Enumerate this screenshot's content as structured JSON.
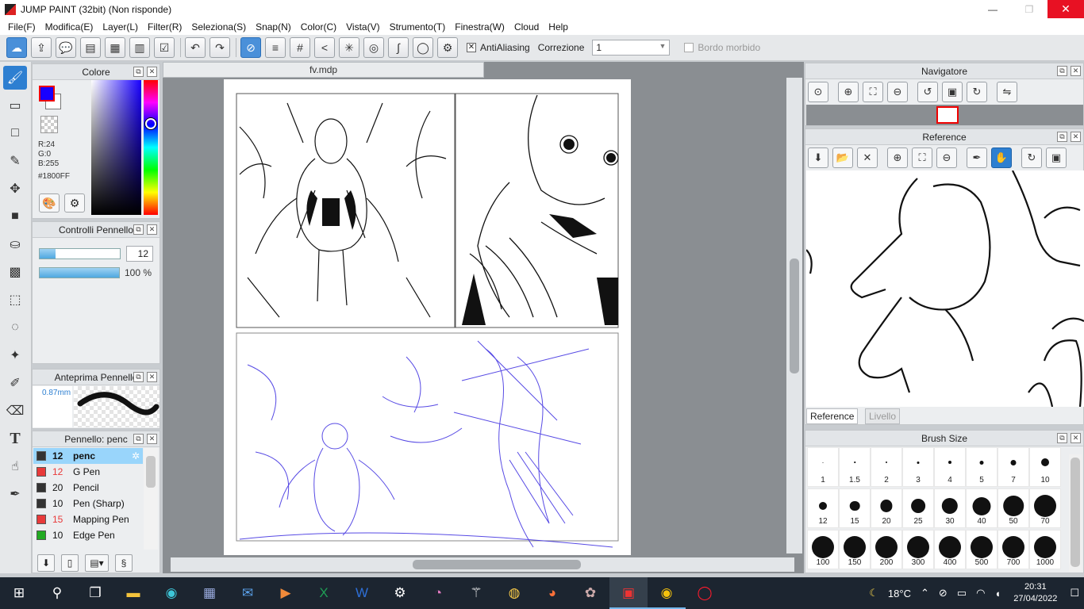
{
  "window": {
    "title": "JUMP PAINT (32bit) (Non risponde)",
    "minimize": "—",
    "maximize": "❐",
    "close": "✕"
  },
  "menu": [
    "File(F)",
    "Modifica(E)",
    "Layer(L)",
    "Filter(R)",
    "Seleziona(S)",
    "Snap(N)",
    "Color(C)",
    "Vista(V)",
    "Strumento(T)",
    "Finestra(W)",
    "Cloud",
    "Help"
  ],
  "toolbar": {
    "antialiasing_label": "AntiAliasing",
    "antialiasing_checked": "✕",
    "correzione_label": "Correzione",
    "correzione_value": "1",
    "bordo_label": "Bordo morbido"
  },
  "color_panel": {
    "title": "Colore",
    "r": "R:24",
    "g": "G:0",
    "b": "B:255",
    "hex": "#1800FF",
    "fore_color": "#1800ff"
  },
  "brush_controls": {
    "title": "Controlli Pennello",
    "size_value": "12",
    "size_fill": 0.2,
    "opacity_value": "100 %",
    "opacity_fill": 1.0
  },
  "brush_preview": {
    "title": "Anteprima Pennello",
    "size_mm": "0.87mm"
  },
  "brush_list": {
    "title": "Pennello: penc",
    "items": [
      {
        "size": "12",
        "name": "penc",
        "color": "#333333"
      },
      {
        "size": "12",
        "name": "G Pen",
        "color": "#e83a3a"
      },
      {
        "size": "20",
        "name": "Pencil",
        "color": "#333333"
      },
      {
        "size": "10",
        "name": "Pen (Sharp)",
        "color": "#333333"
      },
      {
        "size": "15",
        "name": "Mapping Pen",
        "color": "#e83a3a"
      },
      {
        "size": "10",
        "name": "Edge Pen",
        "color": "#22aa22"
      }
    ]
  },
  "document": {
    "tab": "fv.mdp"
  },
  "navigator": {
    "title": "Navigatore"
  },
  "reference": {
    "title": "Reference",
    "tab_active": "Reference",
    "tab_inactive": "Livello"
  },
  "brush_size": {
    "title": "Brush Size",
    "sizes": [
      "1",
      "1.5",
      "2",
      "3",
      "4",
      "5",
      "7",
      "10",
      "12",
      "15",
      "20",
      "25",
      "30",
      "40",
      "50",
      "70",
      "100",
      "150",
      "200",
      "300",
      "400",
      "500",
      "700",
      "1000"
    ]
  },
  "taskbar": {
    "weather": "18°C",
    "time": "20:31",
    "date": "27/04/2022"
  }
}
